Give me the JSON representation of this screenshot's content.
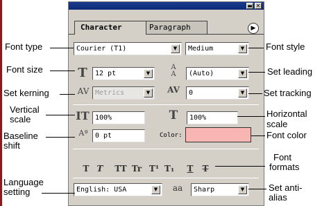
{
  "palette": {
    "tabs": [
      {
        "label": "Character"
      },
      {
        "label": "Paragraph"
      }
    ],
    "menu_icon": "circle-arrow-icon",
    "window_buttons": {
      "minimize": "▬",
      "close": "✕"
    }
  },
  "fields": {
    "font_type": "Courier (T1)",
    "font_style": "Medium",
    "font_size": "12 pt",
    "leading": "(Auto)",
    "kerning": "Metrics",
    "tracking": "0",
    "vertical_scale": "100%",
    "horizontal_scale": "100%",
    "baseline_shift": "0 pt",
    "color_label": "Color:",
    "language": "English: USA",
    "antialias": "Sharp",
    "antialias_glyph": "aa"
  },
  "colors": {
    "font_color_swatch": "#f7b6b2",
    "titlebar": "#0b2a78",
    "left_bar": "#8b1a1a"
  },
  "format_buttons": [
    "T",
    "T",
    "TT",
    "Tr",
    "T¹",
    "T₁",
    "T",
    "T"
  ],
  "callouts": {
    "font_type": "Font type",
    "font_style": "Font style",
    "font_size": "Font size",
    "set_leading": "Set leading",
    "set_kerning": "Set kerning",
    "set_tracking": "Set tracking",
    "vertical_scale_l1": "Vertical",
    "vertical_scale_l2": "scale",
    "horizontal_scale_l1": "Horizontal",
    "horizontal_scale_l2": "scale",
    "baseline_shift_l1": "Baseline",
    "baseline_shift_l2": "shift",
    "font_color": "Font color",
    "font_formats_l1": "Font",
    "font_formats_l2": "formats",
    "language_l1": "Language",
    "language_l2": "setting",
    "antialias_l1": "Set anti-",
    "antialias_l2": "alias"
  }
}
